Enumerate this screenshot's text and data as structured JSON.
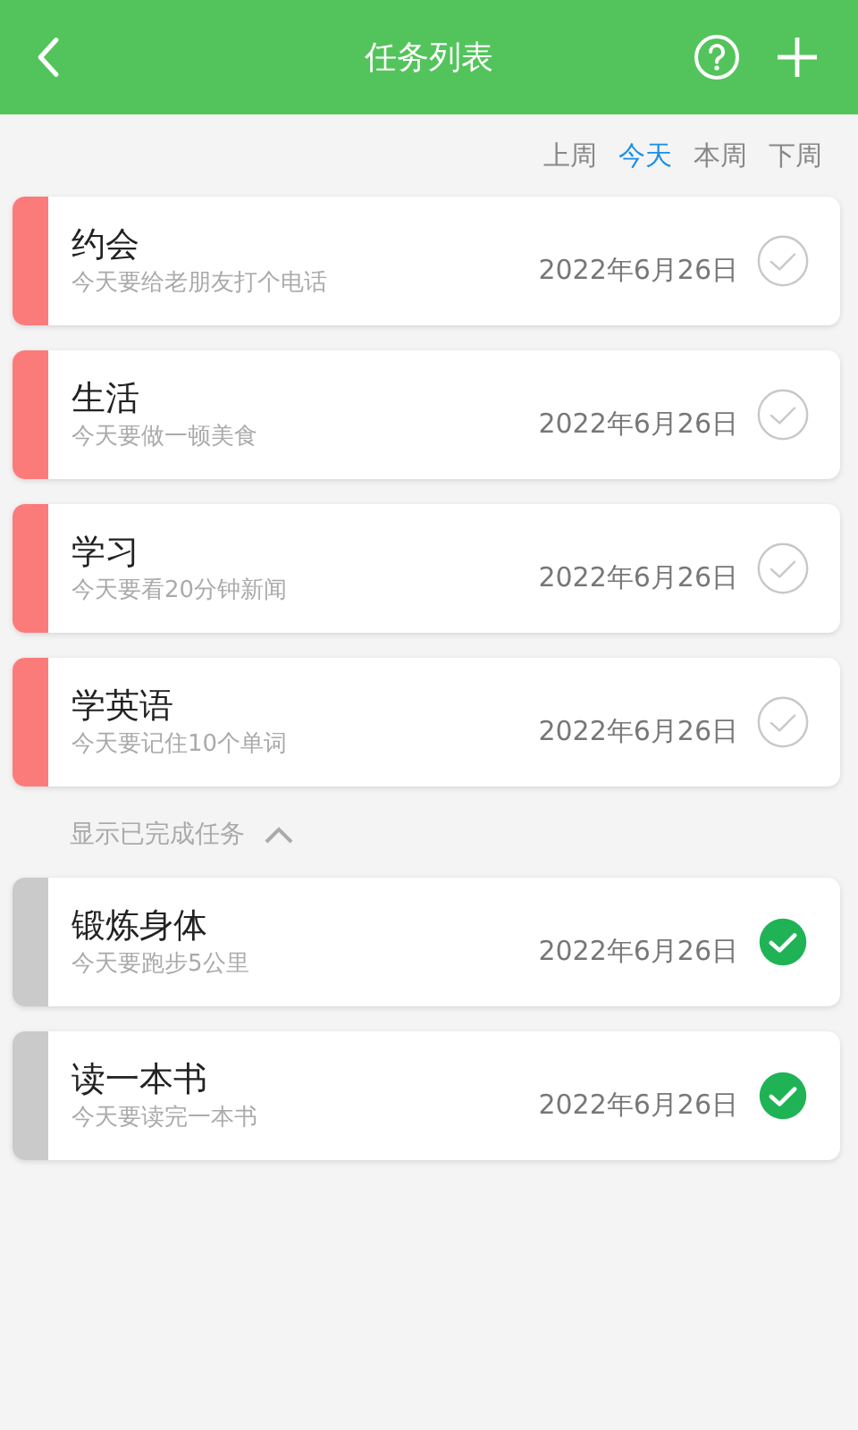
{
  "header": {
    "title": "任务列表"
  },
  "periods": [
    {
      "label": "上周",
      "selected": false
    },
    {
      "label": "今天",
      "selected": true
    },
    {
      "label": "本周",
      "selected": false
    },
    {
      "label": "下周",
      "selected": false
    }
  ],
  "tasks": [
    {
      "title": "约会",
      "note": "今天要给老朋友打个电话",
      "date": "2022年6月26日",
      "done": false
    },
    {
      "title": "生活",
      "note": "今天要做一顿美食",
      "date": "2022年6月26日",
      "done": false
    },
    {
      "title": "学习",
      "note": "今天要看20分钟新闻",
      "date": "2022年6月26日",
      "done": false
    },
    {
      "title": "学英语",
      "note": "今天要记住10个单词",
      "date": "2022年6月26日",
      "done": false
    }
  ],
  "completed_toggle": {
    "label": "显示已完成任务",
    "expanded": true
  },
  "completed_tasks": [
    {
      "title": "锻炼身体",
      "note": "今天要跑步5公里",
      "date": "2022年6月26日",
      "done": true
    },
    {
      "title": "读一本书",
      "note": "今天要读完一本书",
      "date": "2022年6月26日",
      "done": true
    }
  ]
}
